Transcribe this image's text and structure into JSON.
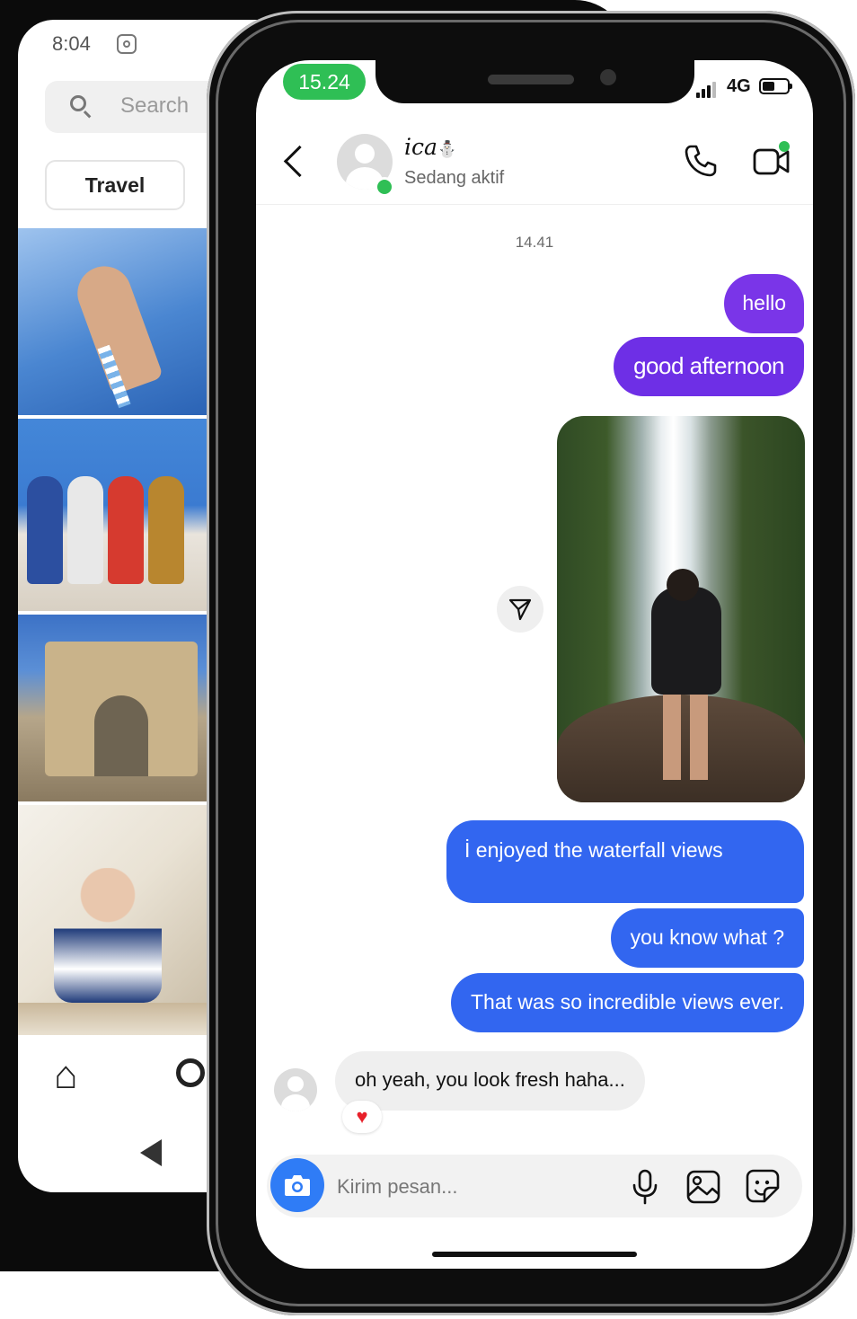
{
  "back_phone": {
    "status_time": "8:04",
    "search": {
      "placeholder": "Search"
    },
    "chip_label": "Travel"
  },
  "status_bar": {
    "time": "15.24",
    "network": "4G"
  },
  "chat_header": {
    "name": "ica",
    "name_emoji": "⛄",
    "status": "Sedang aktif"
  },
  "thread": {
    "timestamp": "14.41",
    "messages_top": [
      {
        "text": "hello"
      },
      {
        "text": "good afternoon"
      }
    ],
    "messages_bottom": [
      {
        "text": "İ enjoyed the waterfall views"
      },
      {
        "text": "you know what ?"
      },
      {
        "text": "That was so incredible views ever."
      }
    ],
    "received": {
      "text": "oh yeah, you look fresh haha...",
      "reaction": "♥"
    }
  },
  "composer": {
    "placeholder": "Kirim pesan..."
  },
  "colors": {
    "sent_purple": "#7a35e8",
    "sent_blue": "#3266f0",
    "online_green": "#2fbf55",
    "camera_blue": "#2f7cf6"
  }
}
